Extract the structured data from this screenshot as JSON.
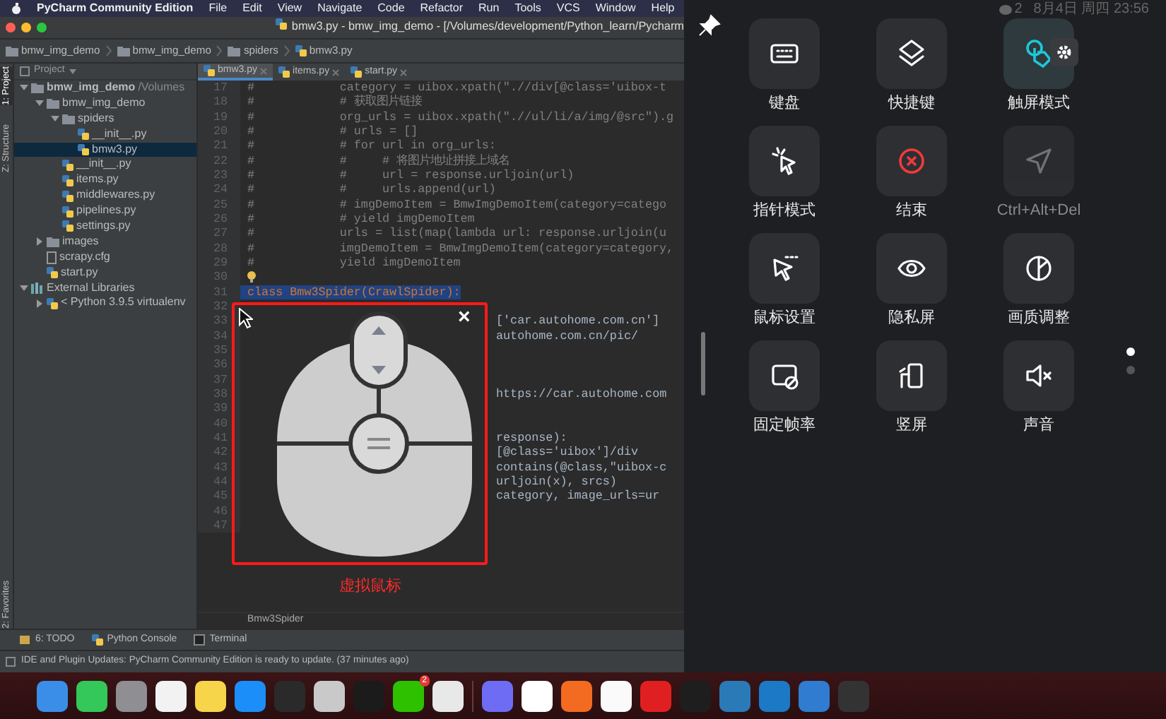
{
  "menu_bar": {
    "app": "PyCharm Community Edition",
    "items": [
      "File",
      "Edit",
      "View",
      "Navigate",
      "Code",
      "Refactor",
      "Run",
      "Tools",
      "VCS",
      "Window",
      "Help"
    ]
  },
  "title_bar": {
    "title": "bmw3.py - bmw_img_demo - [/Volumes/development/Python_learn/Pycharm"
  },
  "breadcrumbs": [
    {
      "label": "bmw_img_demo",
      "kind": "folder"
    },
    {
      "label": "bmw_img_demo",
      "kind": "folder"
    },
    {
      "label": "spiders",
      "kind": "folder"
    },
    {
      "label": "bmw3.py",
      "kind": "file"
    }
  ],
  "tool_strip": [
    {
      "label": "1: Project",
      "selected": true
    },
    {
      "label": "Z: Structure",
      "selected": false
    },
    {
      "label": "2: Favorites",
      "selected": false
    }
  ],
  "project_panel": {
    "header": "Project",
    "tree": [
      {
        "label": "bmw_img_demo",
        "suffix": "/Volumes",
        "kind": "folder",
        "expanded": true,
        "selected": false,
        "children": [
          {
            "label": "bmw_img_demo",
            "kind": "folder",
            "expanded": true,
            "selected": false,
            "children": [
              {
                "label": "spiders",
                "kind": "folder",
                "expanded": true,
                "selected": false,
                "children": [
                  {
                    "label": "__init__.py",
                    "kind": "file",
                    "selected": false
                  },
                  {
                    "label": "bmw3.py",
                    "kind": "file",
                    "selected": true
                  }
                ]
              },
              {
                "label": "__init__.py",
                "kind": "file",
                "selected": false
              },
              {
                "label": "items.py",
                "kind": "file",
                "selected": false
              },
              {
                "label": "middlewares.py",
                "kind": "file",
                "selected": false
              },
              {
                "label": "pipelines.py",
                "kind": "file",
                "selected": false
              },
              {
                "label": "settings.py",
                "kind": "file",
                "selected": false
              }
            ]
          },
          {
            "label": "images",
            "kind": "folder",
            "expanded": false,
            "selected": false
          },
          {
            "label": "scrapy.cfg",
            "kind": "config",
            "selected": false
          },
          {
            "label": "start.py",
            "kind": "file",
            "selected": false
          }
        ]
      },
      {
        "label": "External Libraries",
        "kind": "library",
        "expanded": true,
        "selected": false,
        "children": [
          {
            "label": "< Python 3.9.5 virtualenv",
            "kind": "file",
            "expanded": false,
            "selected": false
          }
        ]
      }
    ]
  },
  "editor": {
    "tabs": [
      {
        "label": "bmw3.py",
        "selected": true
      },
      {
        "label": "items.py",
        "selected": false
      },
      {
        "label": "start.py",
        "selected": false
      }
    ],
    "lines": [
      {
        "number": "17",
        "kind": "comment",
        "text": "#            category = uibox.xpath(\".//div[@class='uibox-t"
      },
      {
        "number": "18",
        "kind": "comment",
        "text": "#            # 获取图片链接"
      },
      {
        "number": "19",
        "kind": "comment",
        "text": "#            org_urls = uibox.xpath(\".//ul/li/a/img/@src\").g"
      },
      {
        "number": "20",
        "kind": "comment",
        "text": "#            # urls = []"
      },
      {
        "number": "21",
        "kind": "comment",
        "text": "#            # for url in org_urls:"
      },
      {
        "number": "22",
        "kind": "comment",
        "text": "#            #     # 将图片地址拼接上域名"
      },
      {
        "number": "23",
        "kind": "comment",
        "text": "#            #     url = response.urljoin(url)"
      },
      {
        "number": "24",
        "kind": "comment",
        "text": "#            #     urls.append(url)"
      },
      {
        "number": "25",
        "kind": "comment",
        "text": "#            # imgDemoItem = BmwImgDemoItem(category=catego"
      },
      {
        "number": "26",
        "kind": "comment",
        "text": "#            # yield imgDemoItem"
      },
      {
        "number": "27",
        "kind": "comment",
        "text": "#            urls = list(map(lambda url: response.urljoin(u"
      },
      {
        "number": "28",
        "kind": "comment",
        "text": "#            imgDemoItem = BmwImgDemoItem(category=category,"
      },
      {
        "number": "29",
        "kind": "comment",
        "text": "#            yield imgDemoItem"
      },
      {
        "number": "30",
        "kind": "hint"
      },
      {
        "number": "31",
        "kind": "selection",
        "text": "class Bmw3Spider(CrawlSpider):"
      },
      {
        "number": "32",
        "kind": "blank"
      },
      {
        "number": "33",
        "kind": "partial",
        "text": "['car.autohome.com.cn']"
      },
      {
        "number": "34",
        "kind": "partial",
        "text": "autohome.com.cn/pic/"
      },
      {
        "number": "35",
        "kind": "blank"
      },
      {
        "number": "36",
        "kind": "blank"
      },
      {
        "number": "37",
        "kind": "blank"
      },
      {
        "number": "38",
        "kind": "partial",
        "text": "https://car.autohome.com"
      },
      {
        "number": "39",
        "kind": "blank"
      },
      {
        "number": "40",
        "kind": "blank"
      },
      {
        "number": "41",
        "kind": "partial",
        "text": "response):"
      },
      {
        "number": "42",
        "kind": "partial",
        "text": "[@class='uibox']/div"
      },
      {
        "number": "43",
        "kind": "partial",
        "text": "contains(@class,\"uibox-c"
      },
      {
        "number": "44",
        "kind": "partial",
        "text": "urljoin(x), srcs)"
      },
      {
        "number": "45",
        "kind": "partial",
        "text": "category, image_urls=ur"
      },
      {
        "number": "46",
        "kind": "blank"
      },
      {
        "number": "47",
        "kind": "blank"
      }
    ],
    "breadcrumb": "Bmw3Spider"
  },
  "virtual_mouse": {
    "close": "×",
    "caption": "虚拟鼠标"
  },
  "tool_tabs": [
    "6: TODO",
    "Python Console",
    "Terminal"
  ],
  "status_bar": "IDE and Plugin Updates: PyCharm Community Edition is ready to update. (37 minutes ago)",
  "remote_panel": {
    "status": {
      "badge": "2",
      "clock": "8月4日 周四 23:56"
    },
    "tiles": [
      {
        "label": "键盘",
        "active": false,
        "disabled": false
      },
      {
        "label": "快捷键",
        "active": false,
        "disabled": false
      },
      {
        "label": "触屏模式",
        "active": true,
        "disabled": false
      },
      {
        "label": "指针模式",
        "active": false,
        "disabled": false
      },
      {
        "label": "结束",
        "active": false,
        "disabled": false
      },
      {
        "label": "Ctrl+Alt+Del",
        "active": false,
        "disabled": true
      },
      {
        "label": "鼠标设置",
        "active": false,
        "disabled": false
      },
      {
        "label": "隐私屏",
        "active": false,
        "disabled": false
      },
      {
        "label": "画质调整",
        "active": false,
        "disabled": false
      },
      {
        "label": "固定帧率",
        "active": false,
        "disabled": false
      },
      {
        "label": "竖屏",
        "active": false,
        "disabled": false
      },
      {
        "label": "声音",
        "active": false,
        "disabled": false
      }
    ],
    "pages": [
      {
        "selected": true
      },
      {
        "selected": false
      }
    ]
  },
  "dock": {
    "apps": [
      {
        "color": "#3b8ee8"
      },
      {
        "color": "#34c759"
      },
      {
        "color": "#8e8e93"
      },
      {
        "color": "#f2f2f2"
      },
      {
        "color": "#f7d54a"
      },
      {
        "color": "#1c8ef9"
      },
      {
        "color": "#2a2a2a"
      },
      {
        "color": "#c9c9c9"
      },
      {
        "color": "#1b1b1b"
      },
      {
        "color": "#2dc100",
        "badge": "2"
      },
      {
        "color": "#e8e8e8"
      },
      {
        "color": "#6e6cf5"
      },
      {
        "color": "#ffffff"
      },
      {
        "color": "#f36b21"
      },
      {
        "color": "#fafafa"
      },
      {
        "color": "#e02020"
      },
      {
        "color": "#1e1e1e"
      },
      {
        "color": "#2a7ab8"
      },
      {
        "color": "#1b79c6"
      },
      {
        "color": "#2f7cd1"
      },
      {
        "color": "#333333"
      }
    ]
  }
}
